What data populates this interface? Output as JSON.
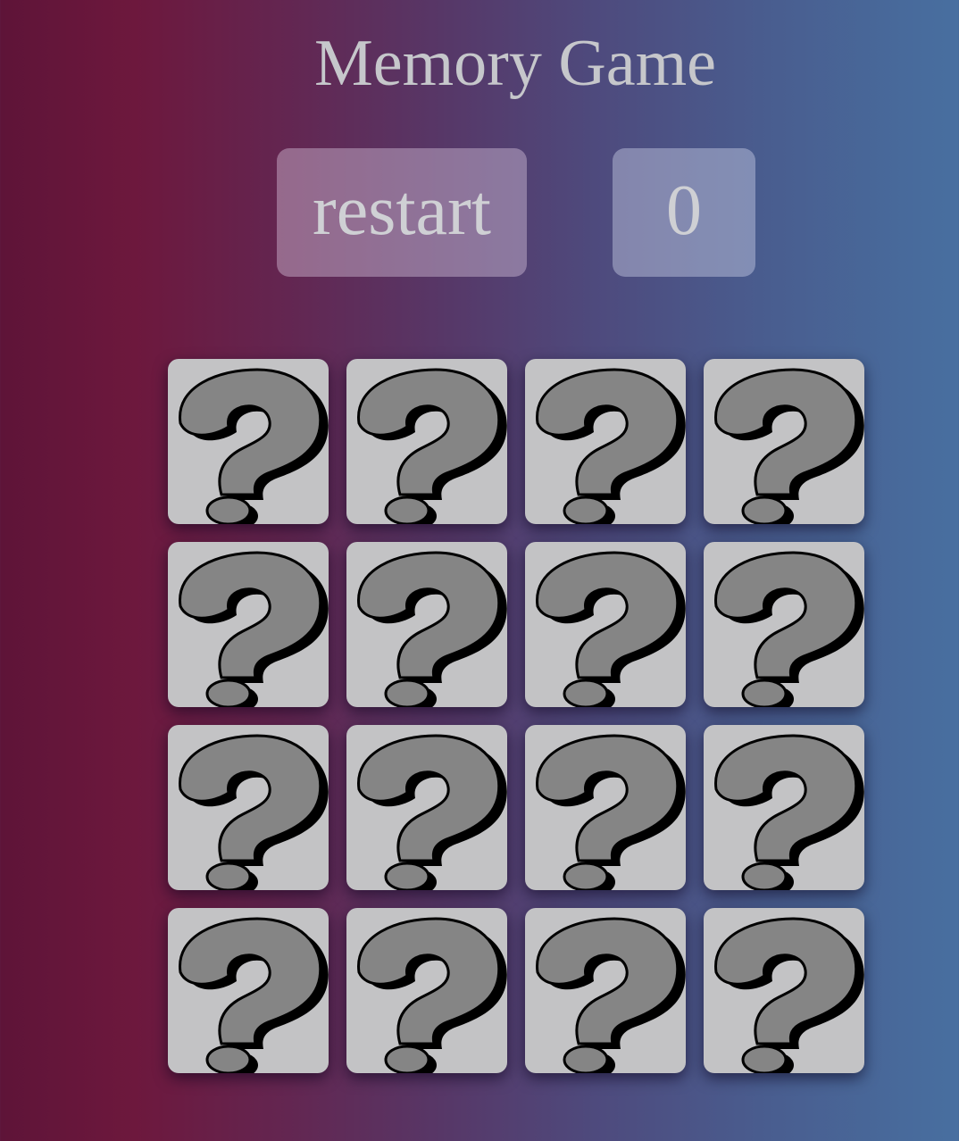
{
  "header": {
    "title": "Memory Game"
  },
  "controls": {
    "restart_label": "restart",
    "score": "0"
  },
  "board": {
    "rows": 4,
    "columns": 4,
    "cards": [
      {
        "state": "face-down",
        "icon": "question-mark-icon"
      },
      {
        "state": "face-down",
        "icon": "question-mark-icon"
      },
      {
        "state": "face-down",
        "icon": "question-mark-icon"
      },
      {
        "state": "face-down",
        "icon": "question-mark-icon"
      },
      {
        "state": "face-down",
        "icon": "question-mark-icon"
      },
      {
        "state": "face-down",
        "icon": "question-mark-icon"
      },
      {
        "state": "face-down",
        "icon": "question-mark-icon"
      },
      {
        "state": "face-down",
        "icon": "question-mark-icon"
      },
      {
        "state": "face-down",
        "icon": "question-mark-icon"
      },
      {
        "state": "face-down",
        "icon": "question-mark-icon"
      },
      {
        "state": "face-down",
        "icon": "question-mark-icon"
      },
      {
        "state": "face-down",
        "icon": "question-mark-icon"
      },
      {
        "state": "face-down",
        "icon": "question-mark-icon"
      },
      {
        "state": "face-down",
        "icon": "question-mark-icon"
      },
      {
        "state": "face-down",
        "icon": "question-mark-icon"
      },
      {
        "state": "face-down",
        "icon": "question-mark-icon"
      }
    ]
  },
  "colors": {
    "card_back": "#c3c3c5",
    "glyph_fill": "#858585",
    "glyph_shadow": "#000000",
    "text": "#c6c7cb"
  }
}
